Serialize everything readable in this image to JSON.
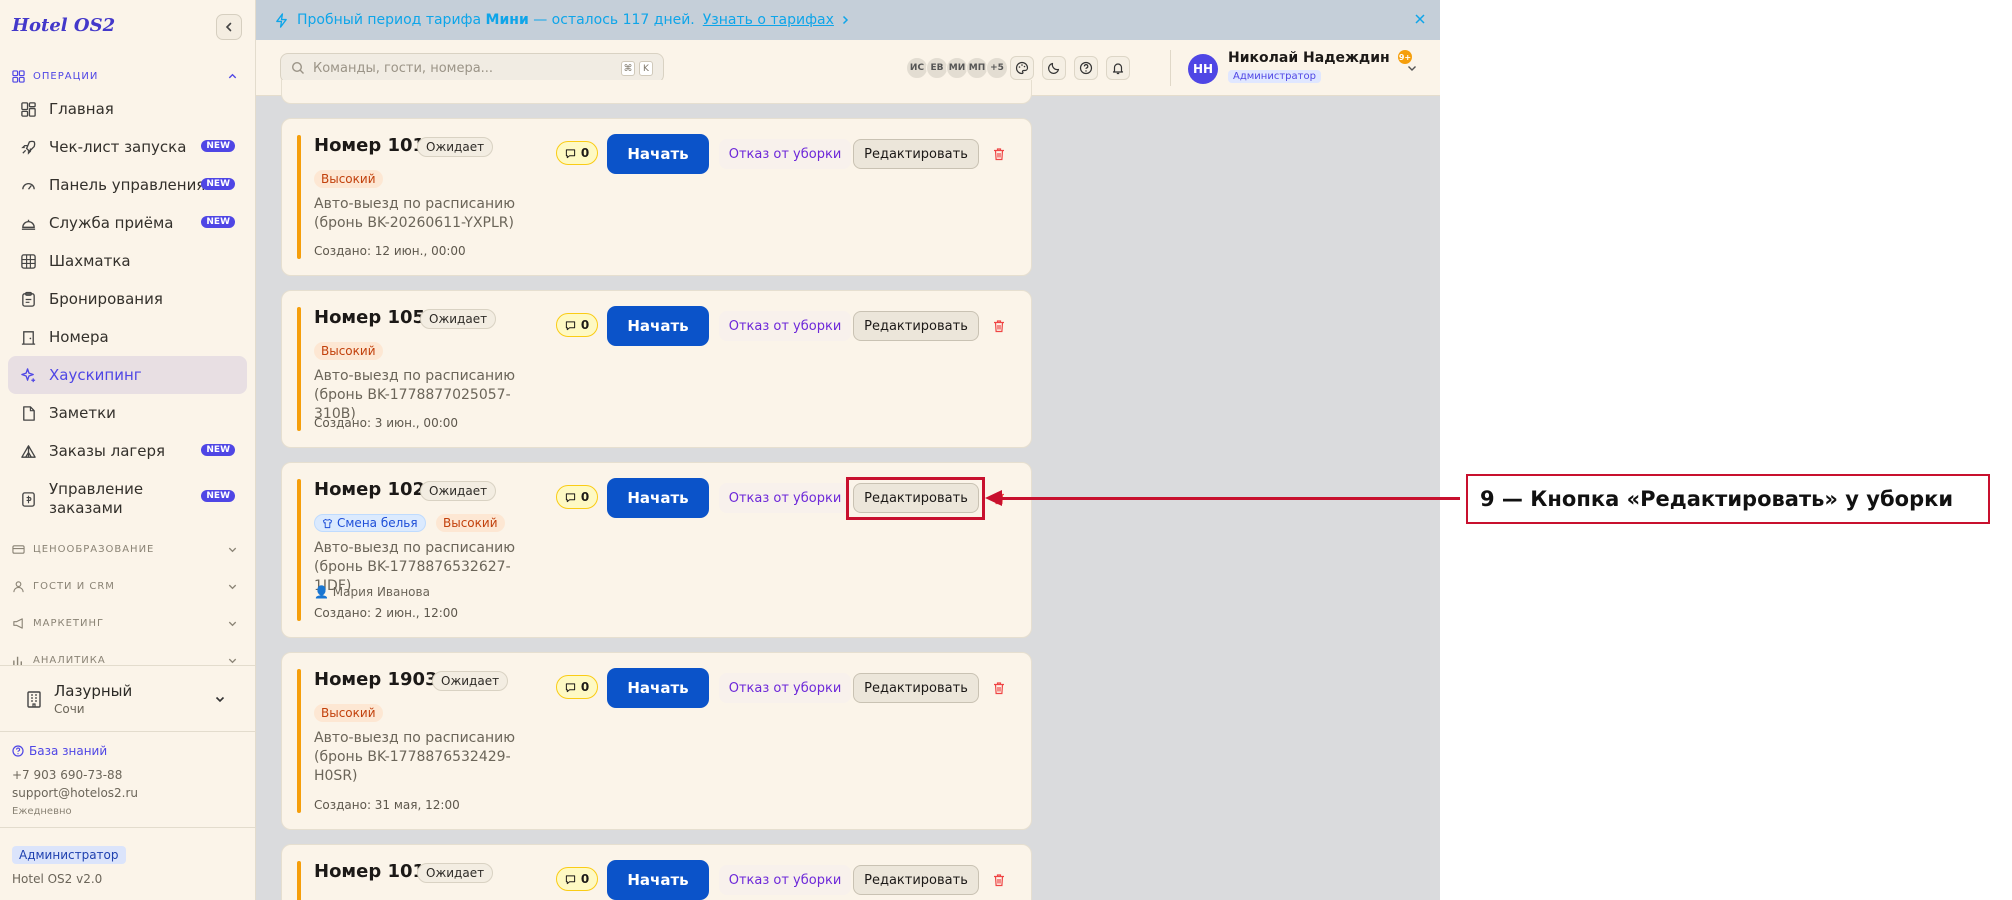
{
  "app": {
    "logo": "Hotel OS2"
  },
  "banner": {
    "text_prefix": "Пробный период тарифа",
    "plan": "Мини",
    "text_suffix": "— осталось 117 дней.",
    "link": "Узнать о тарифах"
  },
  "sidebar": {
    "section_ops": "ОПЕРАЦИИ",
    "items": [
      {
        "label": "Главная",
        "icon": "home-grid-icon"
      },
      {
        "label": "Чек-лист запуска",
        "icon": "rocket-icon",
        "badge": "NEW"
      },
      {
        "label": "Панель управления",
        "icon": "gauge-icon",
        "badge": "NEW"
      },
      {
        "label": "Служба приёма",
        "icon": "bell-desk-icon",
        "badge": "NEW"
      },
      {
        "label": "Шахматка",
        "icon": "grid-icon"
      },
      {
        "label": "Бронирования",
        "icon": "clipboard-icon"
      },
      {
        "label": "Номера",
        "icon": "door-icon"
      },
      {
        "label": "Хаускипинг",
        "icon": "sparkles-icon"
      },
      {
        "label": "Заметки",
        "icon": "note-icon"
      },
      {
        "label": "Заказы лагеря",
        "icon": "tent-icon",
        "badge": "NEW"
      },
      {
        "label_line1": "Управление",
        "label_line2": "заказами",
        "icon": "orders-icon",
        "badge": "NEW"
      }
    ],
    "sections": [
      "ЦЕНООБРАЗОВАНИЕ",
      "ГОСТИ И CRM",
      "МАРКЕТИНГ",
      "АНАЛИТИКА"
    ],
    "hotel": {
      "name": "Лазурный",
      "city": "Сочи"
    },
    "footer": {
      "kb": "База знаний",
      "phone": "+7 903 690-73-88",
      "email": "support@hotelos2.ru",
      "schedule": "Ежедневно",
      "role": "Администратор",
      "version": "Hotel OS2 v2.0"
    }
  },
  "header": {
    "search_placeholder": "Команды, гости, номера...",
    "kbd1": "⌘",
    "kbd2": "K",
    "avatars": [
      "ИС",
      "ЕВ",
      "МИ",
      "МП",
      "+5"
    ],
    "notif_count": "9+",
    "user": {
      "initials": "НН",
      "name": "Николай Надеждин",
      "role": "Администратор"
    }
  },
  "tasks": [
    {
      "room": "Номер 101",
      "status": "Ожидает",
      "priority": "Высокий",
      "desc": "Авто-выезд по расписанию (бронь BK-20260611-YXPLR)",
      "created": "Создано: 12 июн., 00:00",
      "comments": "0"
    },
    {
      "room": "Номер 105",
      "status": "Ожидает",
      "priority": "Высокий",
      "desc": "Авто-выезд по расписанию (бронь BK-1778877025057-310B)",
      "created": "Создано: 3 июн., 00:00",
      "comments": "0"
    },
    {
      "room": "Номер 102",
      "status": "Ожидает",
      "tag": "Смена белья",
      "priority": "Высокий",
      "desc": "Авто-выезд по расписанию (бронь BK-1778876532627-1IDF)",
      "assignee": "Мария Иванова",
      "created": "Создано: 2 июн., 12:00",
      "comments": "0"
    },
    {
      "room": "Номер 1903",
      "status": "Ожидает",
      "priority": "Высокий",
      "desc": "Авто-выезд по расписанию (бронь BK-1778876532429-H0SR)",
      "created": "Создано: 31 мая, 12:00",
      "comments": "0"
    },
    {
      "room": "Номер 101",
      "status": "Ожидает",
      "comments": "0"
    }
  ],
  "actions": {
    "start": "Начать",
    "refuse": "Отказ от уборки",
    "edit": "Редактировать"
  },
  "annotation": {
    "text": "9 — Кнопка «Редактировать» у уборки"
  },
  "colors": {
    "accent": "#4f46e5",
    "primary_button": "#0b53c9",
    "priority_bar": "#f59e0b",
    "annotation": "#c8102e"
  }
}
